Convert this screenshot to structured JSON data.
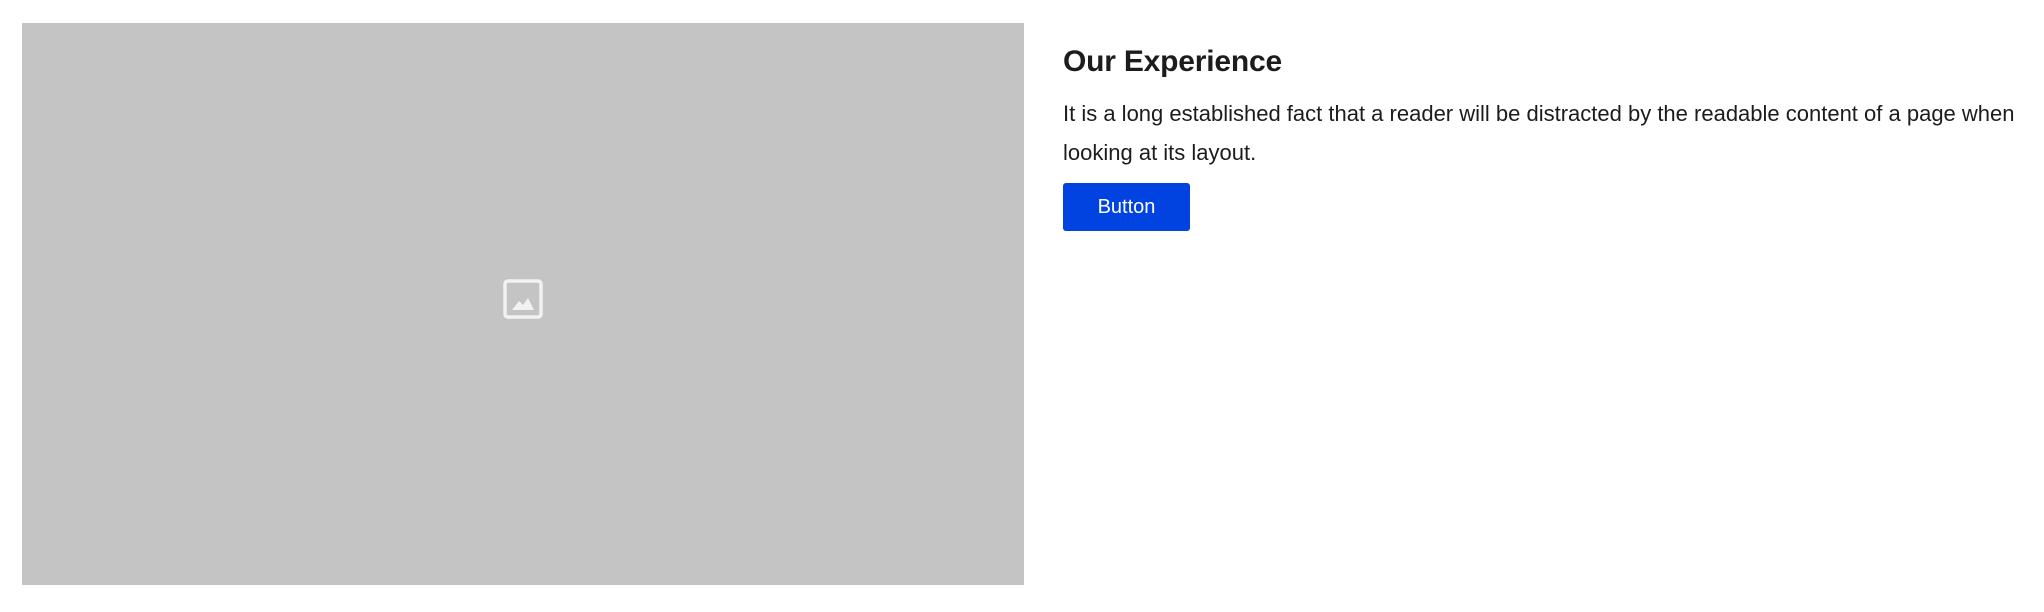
{
  "hero": {
    "image_icon": "image-icon",
    "placeholder_color": "#c4c4c4"
  },
  "content": {
    "title": "Our Experience",
    "description": "It is a long established fact that a reader will be distracted by the readable content of a page when looking at its layout.",
    "button_label": "Button",
    "button_color": "#0043e0"
  }
}
